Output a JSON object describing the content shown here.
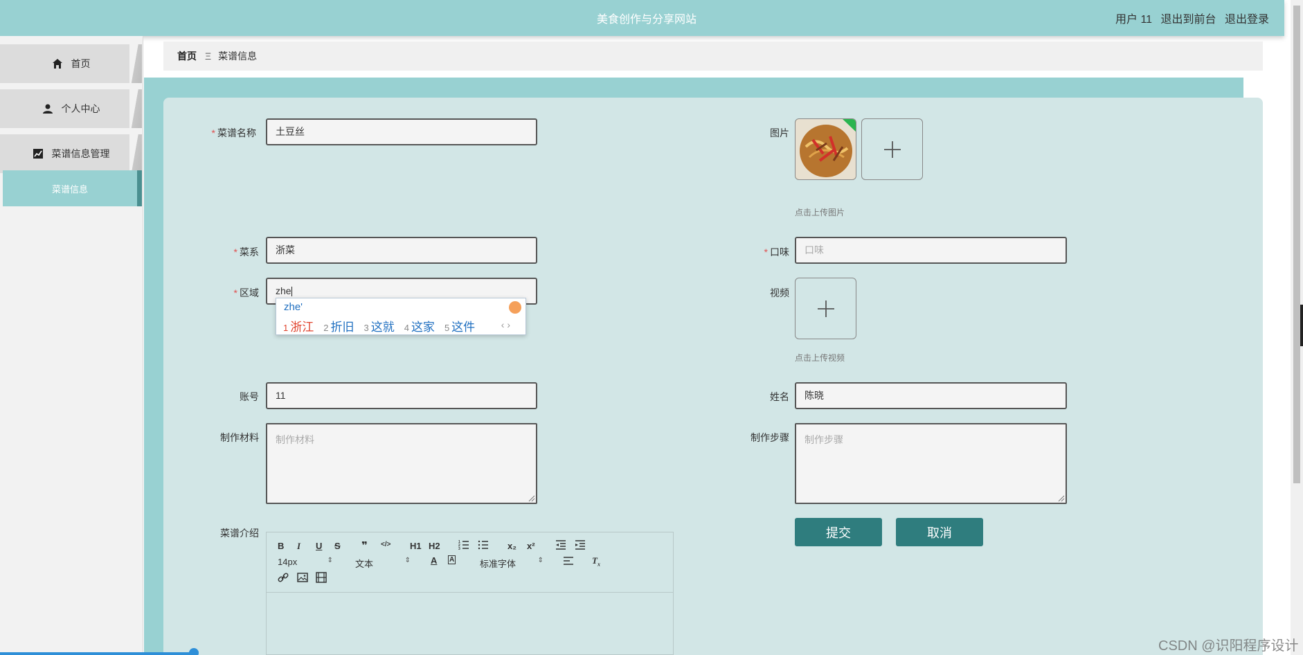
{
  "header": {
    "site_title": "美食创作与分享网站",
    "user_label": "用户 11",
    "back_to_front": "退出到前台",
    "logout": "退出登录"
  },
  "sidebar": {
    "items": [
      {
        "label": "首页",
        "icon": "home-icon"
      },
      {
        "label": "个人中心",
        "icon": "user-icon"
      },
      {
        "label": "菜谱信息管理",
        "icon": "chart-icon"
      }
    ],
    "sub_item": "菜谱信息"
  },
  "breadcrumb": {
    "home": "首页",
    "separator": "Ξ",
    "current": "菜谱信息"
  },
  "form": {
    "name_label": "菜谱名称",
    "name_value": "土豆丝",
    "image_label": "图片",
    "image_hint": "点击上传图片",
    "cuisine_label": "菜系",
    "cuisine_value": "浙菜",
    "taste_label": "口味",
    "taste_placeholder": "口味",
    "region_label": "区域",
    "region_value": "zhe",
    "video_label": "视频",
    "video_hint": "点击上传视频",
    "account_label": "账号",
    "account_value": "11",
    "realname_label": "姓名",
    "realname_value": "陈晓",
    "materials_label": "制作材料",
    "materials_placeholder": "制作材料",
    "steps_label": "制作步骤",
    "steps_placeholder": "制作步骤",
    "intro_label": "菜谱介绍",
    "submit": "提交",
    "cancel": "取消"
  },
  "ime": {
    "pinyin": "zhe'",
    "candidates": [
      {
        "n": "1",
        "w": "浙江"
      },
      {
        "n": "2",
        "w": "折旧"
      },
      {
        "n": "3",
        "w": "这就"
      },
      {
        "n": "4",
        "w": "这家"
      },
      {
        "n": "5",
        "w": "这件"
      }
    ],
    "nav": "‹ ›"
  },
  "editor": {
    "buttons_row1": [
      "B",
      "I",
      "U",
      "S",
      "❞",
      "</>",
      "H1",
      "H2",
      "ol",
      "ul",
      "x₂",
      "x²",
      "outdent",
      "indent"
    ],
    "font_size": "14px",
    "block_type": "文本",
    "font_family": "标准字体"
  },
  "watermark": "CSDN @识阳程序设计",
  "colors": {
    "header_bg": "#98d1d2",
    "accent": "#2f7d7e",
    "card_bg": "#d2e6e6",
    "required": "#e05050"
  }
}
